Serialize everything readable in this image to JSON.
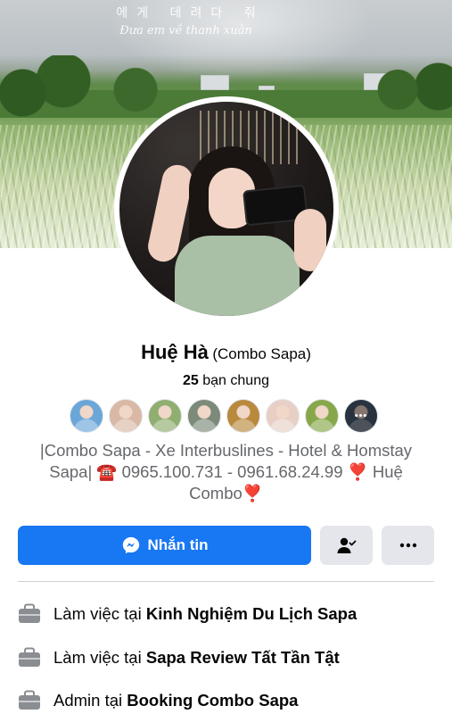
{
  "cover": {
    "script_line": "에게 데려다 줘",
    "subtitle": "Đưa em về thanh xuân"
  },
  "profile": {
    "name": "Huệ Hà",
    "alternate_name": "(Combo Sapa)",
    "mutual_count": "25",
    "mutual_label": "bạn chung",
    "bio": {
      "part1": "|Combo Sapa - Xe Interbuslines - Hotel & Homstay Sapa| ",
      "phone_icon": "☎️",
      "part2": " 0965.100.731 - 0961.68.24.99 ",
      "heart1": "❣️",
      "part3": " Huệ Combo",
      "heart2": "❣️"
    }
  },
  "mutual_friends": [
    {
      "icon": "friend-avatar-1",
      "color": "#6aa6d8"
    },
    {
      "icon": "friend-avatar-2",
      "color": "#d9b8a6"
    },
    {
      "icon": "friend-avatar-3",
      "color": "#8fae6f"
    },
    {
      "icon": "friend-avatar-4",
      "color": "#7c8a7a"
    },
    {
      "icon": "friend-avatar-5",
      "color": "#b9893e"
    },
    {
      "icon": "friend-avatar-6",
      "color": "#e8cfc6"
    },
    {
      "icon": "friend-avatar-7",
      "color": "#86a84a"
    },
    {
      "icon": "friend-avatar-more",
      "color": "#4a5d73"
    }
  ],
  "actions": {
    "message_label": "Nhắn tin",
    "message_icon": "messenger-icon",
    "friends_icon": "friends-check-icon",
    "more_icon": "more-dots-icon"
  },
  "work": [
    {
      "prefix": "Làm việc tại",
      "place": "Kinh Nghiệm Du Lịch Sapa"
    },
    {
      "prefix": "Làm việc tại",
      "place": "Sapa Review Tất Tần Tật"
    },
    {
      "prefix": "Admin tại",
      "place": "Booking Combo Sapa"
    }
  ],
  "colors": {
    "accent": "#1877f2",
    "secondary_button": "#e4e6eb",
    "muted_text": "#65676b",
    "heart": "#e0245e"
  }
}
